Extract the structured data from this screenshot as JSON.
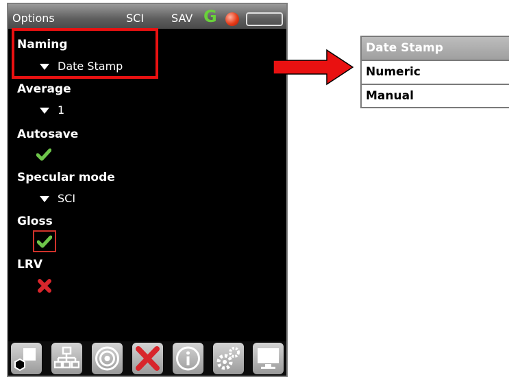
{
  "status": {
    "title": "Options",
    "mode": "SCI",
    "save": "SAV",
    "g_letter": "G"
  },
  "options": [
    {
      "label": "Naming",
      "value": "Date Stamp"
    },
    {
      "label": "Average",
      "value": "1"
    },
    {
      "label": "Autosave",
      "checked": true
    },
    {
      "label": "Specular mode",
      "value": "SCI"
    },
    {
      "label": "Gloss",
      "checked": true
    },
    {
      "label": "LRV",
      "checked": false
    }
  ],
  "dropdown": {
    "items": [
      "Date Stamp",
      "Numeric",
      "Manual"
    ],
    "selected": "Date Stamp"
  },
  "toolbar": {
    "icons": [
      "shapes-icon",
      "network-icon",
      "target-icon",
      "tools-icon",
      "info-icon",
      "settings-icon",
      "monitor-icon"
    ]
  },
  "colors": {
    "check": "#6ec54a",
    "cross": "#d8262c",
    "highlight": "#e91111",
    "arrow": "#e91111"
  }
}
